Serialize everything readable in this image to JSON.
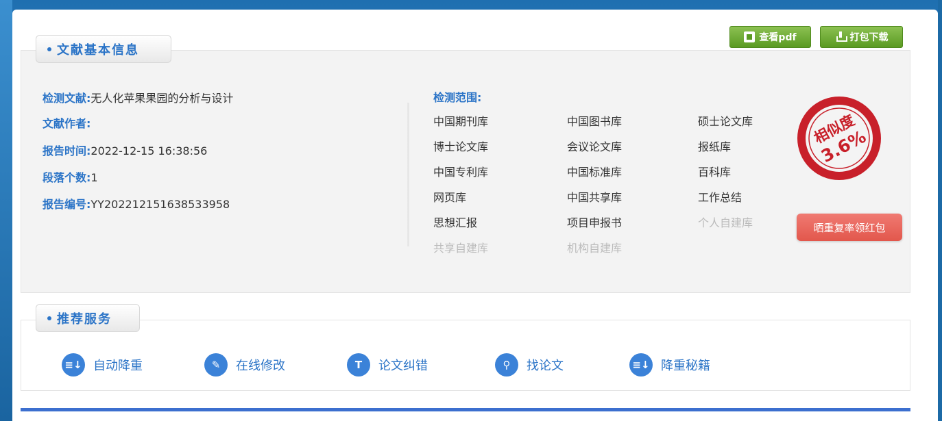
{
  "toolbar": {
    "view_pdf": "查看pdf",
    "download": "打包下载"
  },
  "basic_info": {
    "title": "文献基本信息",
    "fields": [
      {
        "label": "检测文献:",
        "value": "无人化苹果果园的分析与设计"
      },
      {
        "label": "文献作者:",
        "value": ""
      },
      {
        "label": "报告时间:",
        "value": "2022-12-15 16:38:56"
      },
      {
        "label": "段落个数:",
        "value": "1"
      },
      {
        "label": "报告编号:",
        "value": "YY202212151638533958"
      }
    ]
  },
  "scope": {
    "title": "检测范围:",
    "items": [
      {
        "label": "中国期刊库",
        "enabled": true
      },
      {
        "label": "中国图书库",
        "enabled": true
      },
      {
        "label": "硕士论文库",
        "enabled": true
      },
      {
        "label": "博士论文库",
        "enabled": true
      },
      {
        "label": "会议论文库",
        "enabled": true
      },
      {
        "label": "报纸库",
        "enabled": true
      },
      {
        "label": "中国专利库",
        "enabled": true
      },
      {
        "label": "中国标准库",
        "enabled": true
      },
      {
        "label": "百科库",
        "enabled": true
      },
      {
        "label": "网页库",
        "enabled": true
      },
      {
        "label": "中国共享库",
        "enabled": true
      },
      {
        "label": "工作总结",
        "enabled": true
      },
      {
        "label": "思想汇报",
        "enabled": true
      },
      {
        "label": "项目申报书",
        "enabled": true
      },
      {
        "label": "个人自建库",
        "enabled": false
      },
      {
        "label": "共享自建库",
        "enabled": false
      },
      {
        "label": "机构自建库",
        "enabled": false
      }
    ]
  },
  "similarity": {
    "label": "相似度",
    "value": "3.6%",
    "color": "#c8202a"
  },
  "red_packet": "晒重复率领红包",
  "services": {
    "title": "推荐服务",
    "items": [
      {
        "label": "自动降重",
        "icon": "list-down-icon",
        "glyph": "≡↓"
      },
      {
        "label": "在线修改",
        "icon": "pencil-icon",
        "glyph": "✎"
      },
      {
        "label": "论文纠错",
        "icon": "text-t-icon",
        "glyph": "T"
      },
      {
        "label": "找论文",
        "icon": "search-icon",
        "glyph": "⚲"
      },
      {
        "label": "降重秘籍",
        "icon": "list-down-icon",
        "glyph": "≡↓"
      }
    ]
  }
}
